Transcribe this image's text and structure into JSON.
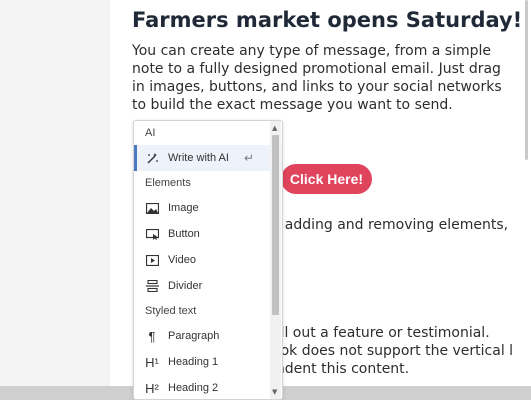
{
  "email": {
    "title": "Farmers market opens Saturday!",
    "paragraph1": "You can create any type of message, from a simple note to a fully designed promotional email. Just drag in images, buttons, and links to your social networks to build the exact message you want to send.",
    "paragraph2_fragment": "y adding and removing elements,",
    "paragraph3_fragment": "all out a feature or testimonial. ook does not support the vertical l indent this content.",
    "cta_label": "Click Here!"
  },
  "menu": {
    "sections": [
      {
        "label": "AI",
        "items": [
          {
            "label": "Write with AI",
            "icon": "magic-wand-icon",
            "active": true,
            "hint": "↵"
          }
        ]
      },
      {
        "label": "Elements",
        "items": [
          {
            "label": "Image",
            "icon": "image-icon"
          },
          {
            "label": "Button",
            "icon": "button-icon"
          },
          {
            "label": "Video",
            "icon": "video-icon"
          },
          {
            "label": "Divider",
            "icon": "divider-icon"
          }
        ]
      },
      {
        "label": "Styled text",
        "items": [
          {
            "label": "Paragraph",
            "icon": "paragraph-icon"
          },
          {
            "label": "Heading 1",
            "icon": "heading-1-icon",
            "glyph": "H¹"
          },
          {
            "label": "Heading 2",
            "icon": "heading-2-icon",
            "glyph": "H²"
          }
        ]
      }
    ]
  },
  "colors": {
    "cta_background": "#e0435c",
    "active_item_background": "#eef3fb"
  }
}
